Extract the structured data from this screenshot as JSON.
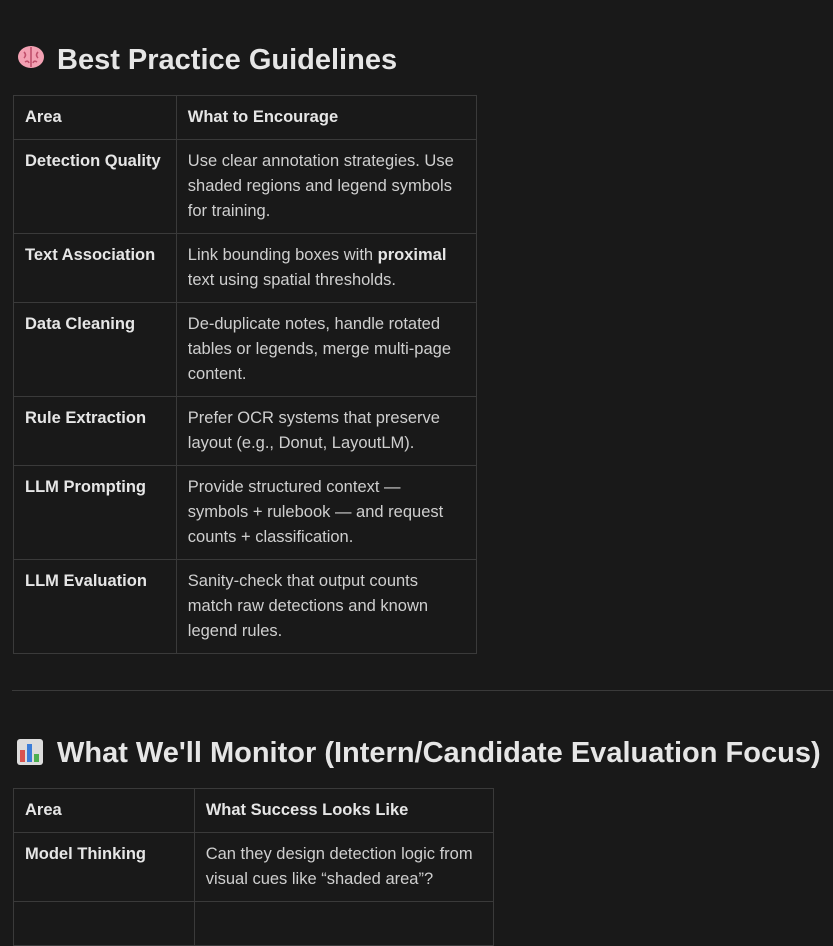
{
  "section1": {
    "emoji": "🧠",
    "title": "Best Practice Guidelines",
    "columns": [
      "Area",
      "What to Encourage"
    ],
    "rows": [
      {
        "area": "Detection Quality",
        "text": "Use clear annotation strategies. Use shaded regions and legend symbols for training."
      },
      {
        "area": "Text Association",
        "pre": "Link bounding boxes with ",
        "bold": "proximal",
        "post": " text using spatial thresholds."
      },
      {
        "area": "Data Cleaning",
        "text": "De-duplicate notes, handle rotated tables or legends, merge multi-page content."
      },
      {
        "area": "Rule Extraction",
        "text": "Prefer OCR systems that preserve layout (e.g., Donut, LayoutLM)."
      },
      {
        "area": "LLM Prompting",
        "text": "Provide structured context — symbols + rulebook — and request counts + classification."
      },
      {
        "area": "LLM Evaluation",
        "text": "Sanity-check that output counts match raw detections and known legend rules."
      }
    ]
  },
  "section2": {
    "emoji": "📊",
    "title": "What We'll Monitor (Intern/Candidate Evaluation Focus)",
    "columns": [
      "Area",
      "What Success Looks Like"
    ],
    "rows": [
      {
        "area": "Model Thinking",
        "text": "Can they design detection logic from visual cues like “shaded area”?"
      }
    ]
  }
}
